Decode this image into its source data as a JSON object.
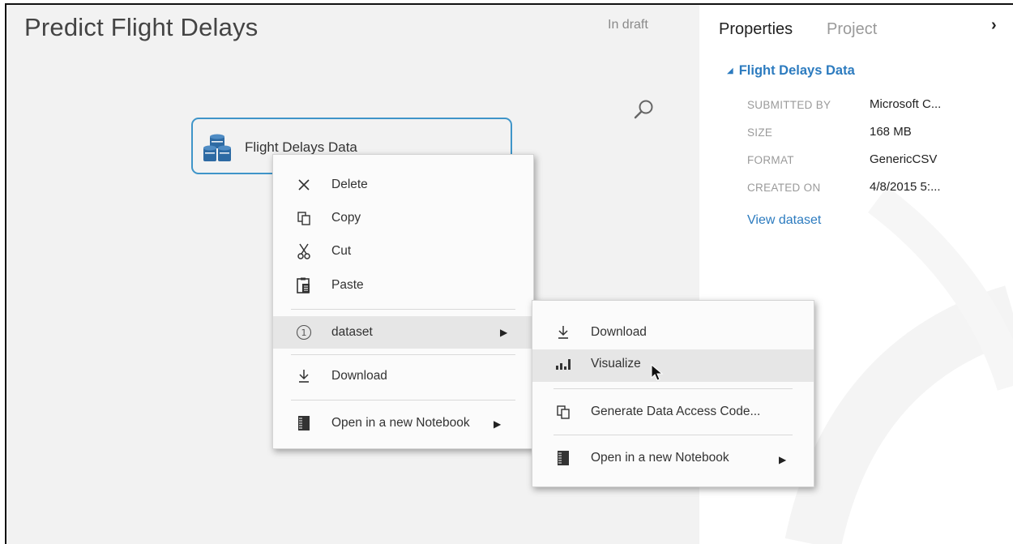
{
  "experiment": {
    "title": "Predict Flight Delays",
    "status": "In draft"
  },
  "module": {
    "label": "Flight Delays Data"
  },
  "context_menu": {
    "items": [
      {
        "label": "Delete",
        "icon": "delete-x-icon"
      },
      {
        "label": "Copy",
        "icon": "copy-icon"
      },
      {
        "label": "Cut",
        "icon": "scissors-icon"
      },
      {
        "label": "Paste",
        "icon": "paste-icon"
      },
      {
        "label": "dataset",
        "icon": "output-port-1-icon",
        "port_number": "1",
        "has_submenu": true
      },
      {
        "label": "Download",
        "icon": "download-icon"
      },
      {
        "label": "Open in a new Notebook",
        "icon": "notebook-icon",
        "has_submenu": true
      }
    ]
  },
  "submenu": {
    "items": [
      {
        "label": "Download",
        "icon": "download-icon"
      },
      {
        "label": "Visualize",
        "icon": "bar-chart-icon",
        "highlighted": true
      },
      {
        "label": "Generate Data Access Code...",
        "icon": "copy-icon"
      },
      {
        "label": "Open in a new Notebook",
        "icon": "notebook-icon",
        "has_submenu": true
      }
    ]
  },
  "properties_panel": {
    "tabs": [
      "Properties",
      "Project"
    ],
    "active_tab": "Properties",
    "collapse_glyph": "›",
    "section_title": "Flight Delays Data",
    "properties": [
      {
        "key": "SUBMITTED BY",
        "value": "Microsoft C..."
      },
      {
        "key": "SIZE",
        "value": "168 MB"
      },
      {
        "key": "FORMAT",
        "value": "GenericCSV"
      },
      {
        "key": "CREATED ON",
        "value": "4/8/2015 5:..."
      }
    ],
    "view_link": "View dataset"
  },
  "colors": {
    "accent_blue": "#2c7bbf",
    "node_border": "#3f95c9",
    "canvas_bg": "#f2f2f2",
    "menu_highlight": "#e6e6e6"
  }
}
